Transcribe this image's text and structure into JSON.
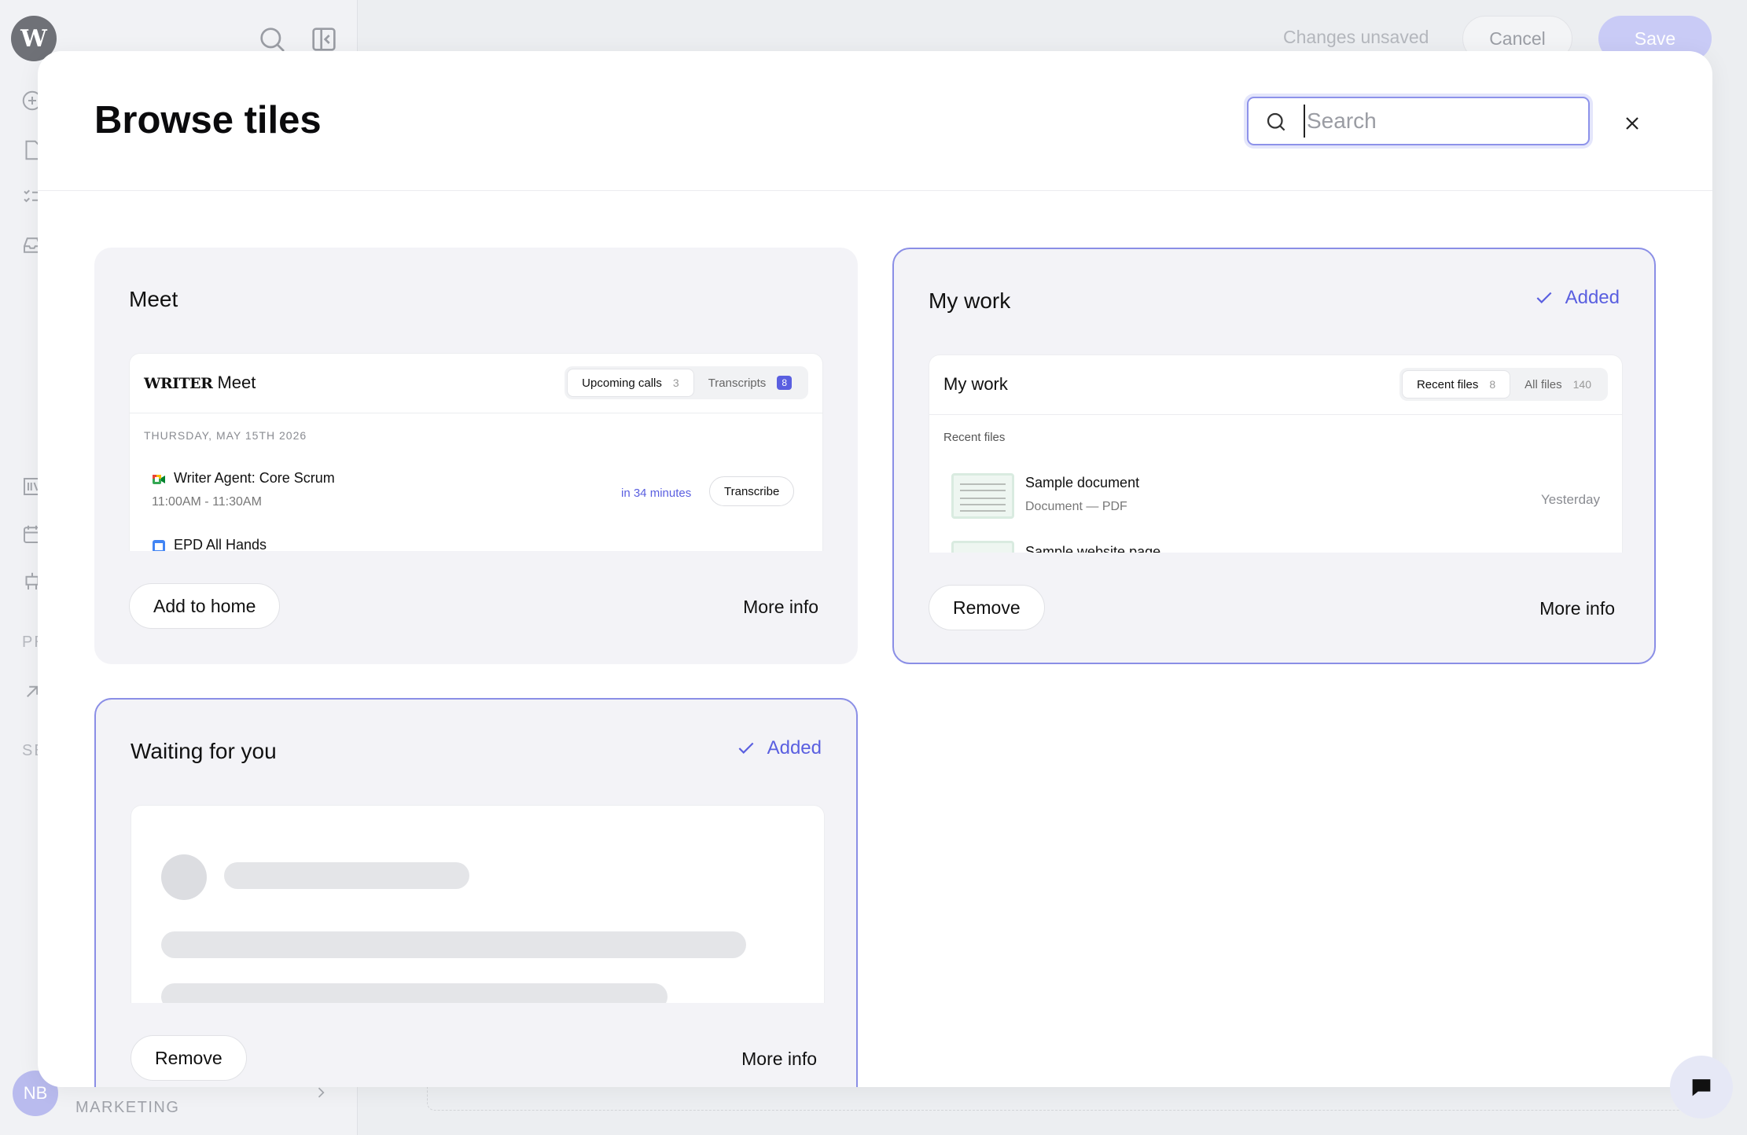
{
  "app": {
    "logo_letter": "W",
    "status": "Changes unsaved",
    "cancel_label": "Cancel",
    "save_label": "Save",
    "sidebar_sections": [
      "PR",
      "SE"
    ],
    "avatar_initials": "NB",
    "workspace": "MARKETING"
  },
  "modal": {
    "title": "Browse tiles",
    "search": {
      "placeholder": "Search",
      "value": ""
    }
  },
  "colors": {
    "accent": "#5a5fe0",
    "accent_border": "#8a8ee6",
    "tile_bg": "#f3f3f7"
  },
  "tiles": [
    {
      "title": "Meet",
      "added": false,
      "button_label": "Add to home",
      "more_info_label": "More info",
      "preview": {
        "brand": "WRITER",
        "brand_suffix": "Meet",
        "tabs": [
          {
            "label": "Upcoming calls",
            "count": "3",
            "active": true
          },
          {
            "label": "Transcripts",
            "count": "8",
            "active": false
          }
        ],
        "date": "THURSDAY, MAY 15TH 2026",
        "events": [
          {
            "title": "Writer Agent: Core Scrum",
            "time": "11:00AM - 11:30AM",
            "in": "in 34 minutes",
            "action": "Transcribe"
          },
          {
            "title": "EPD All Hands"
          }
        ]
      }
    },
    {
      "title": "My work",
      "added": true,
      "added_label": "Added",
      "button_label": "Remove",
      "more_info_label": "More info",
      "preview": {
        "heading": "My work",
        "tabs": [
          {
            "label": "Recent files",
            "count": "8",
            "active": true
          },
          {
            "label": "All files",
            "count": "140",
            "active": false
          }
        ],
        "section": "Recent files",
        "files": [
          {
            "name": "Sample document",
            "meta": "Document — PDF",
            "when": "Yesterday"
          },
          {
            "name": "Sample website page"
          }
        ]
      }
    },
    {
      "title": "Waiting for you",
      "added": true,
      "added_label": "Added",
      "button_label": "Remove",
      "more_info_label": "More info"
    }
  ]
}
